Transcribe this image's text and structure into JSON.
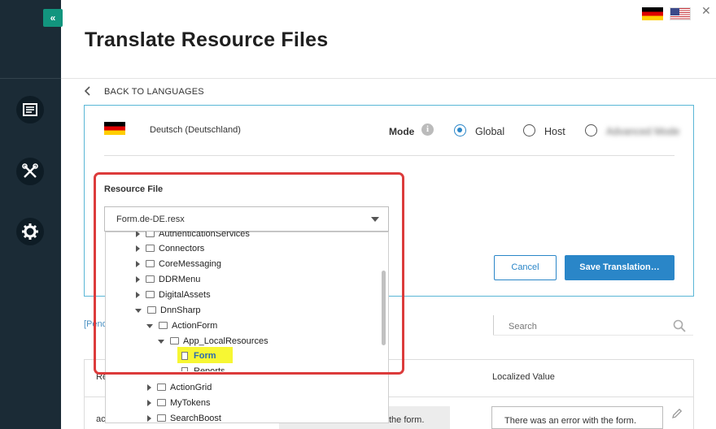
{
  "page": {
    "title": "Translate Resource Files",
    "close_glyph": "✕"
  },
  "sidebar": {
    "collapse_label": "«",
    "icons": [
      "content-icon",
      "tools-icon",
      "settings-gear-icon"
    ]
  },
  "header": {
    "flags": [
      "flag-de-icon",
      "flag-us-icon"
    ]
  },
  "back": {
    "label": "BACK TO LANGUAGES"
  },
  "language": {
    "label": "Deutsch (Deutschland)",
    "flag": "flag-de-icon"
  },
  "mode": {
    "label": "Mode",
    "info_glyph": "i",
    "options": [
      {
        "label": "Global",
        "selected": true
      },
      {
        "label": "Host",
        "selected": false
      },
      {
        "label": "Advanced Mode",
        "selected": false,
        "blurred": true
      }
    ]
  },
  "resource": {
    "label": "Resource File",
    "selected_value": "Form.de-DE.resx"
  },
  "tree": {
    "items": [
      {
        "label": "AuthenticationServices",
        "type": "folder",
        "expander": "right"
      },
      {
        "label": "Connectors",
        "type": "folder",
        "expander": "right"
      },
      {
        "label": "CoreMessaging",
        "type": "folder",
        "expander": "right"
      },
      {
        "label": "DDRMenu",
        "type": "folder",
        "expander": "right"
      },
      {
        "label": "DigitalAssets",
        "type": "folder",
        "expander": "right"
      },
      {
        "label": "DnnSharp",
        "type": "folder",
        "expander": "down"
      },
      {
        "label": "ActionForm",
        "type": "folder",
        "expander": "down"
      },
      {
        "label": "App_LocalResources",
        "type": "folder",
        "expander": "down"
      },
      {
        "label": "Form",
        "type": "file",
        "highlighted": true
      },
      {
        "label": "Reports",
        "type": "file"
      },
      {
        "label": "ActionGrid",
        "type": "folder",
        "expander": "right"
      },
      {
        "label": "MyTokens",
        "type": "folder",
        "expander": "right"
      },
      {
        "label": "SearchBoost",
        "type": "folder",
        "expander": "right"
      }
    ]
  },
  "buttons": {
    "cancel": "Cancel",
    "save": "Save Translation…"
  },
  "filters": {
    "pending": "[Pend",
    "search_placeholder": "Search"
  },
  "table": {
    "col_resource": "Re",
    "col_localized": "Localized Value",
    "row_key": "ac",
    "default_value": "the form.",
    "localized_value": "There was an error with the form."
  },
  "colors": {
    "accent": "#2a86c8",
    "sidebar": "#1b2b36",
    "highlight_border": "#dc3b3b",
    "tree_highlight": "#f7f733"
  }
}
